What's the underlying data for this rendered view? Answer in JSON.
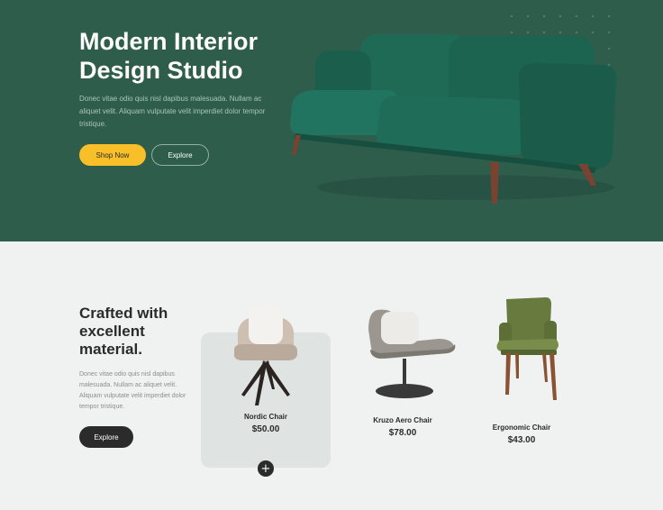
{
  "hero": {
    "title_line1": "Modern Interior",
    "title_line2": "Design Studio",
    "description": "Donec vitae odio quis nisl dapibus malesuada. Nullam ac aliquet velit. Aliquam vulputate velit imperdiet dolor tempor tristique.",
    "shop_label": "Shop Now",
    "explore_label": "Explore",
    "image_icon": "sofa-image"
  },
  "products_section": {
    "title_line1": "Crafted with",
    "title_line2": "excellent",
    "title_line3": "material.",
    "description": "Donec vitae odio quis nisl dapibus malesuada. Nullam ac aliquet velit. Aliquam vulputate velit imperdiet dolor tempor tristique.",
    "explore_label": "Explore",
    "add_icon": "plus-icon",
    "items": [
      {
        "name": "Nordic Chair",
        "price": "$50.00",
        "image_icon": "nordic-chair-image"
      },
      {
        "name": "Kruzo Aero Chair",
        "price": "$78.00",
        "image_icon": "aero-chair-image"
      },
      {
        "name": "Ergonomic Chair",
        "price": "$43.00",
        "image_icon": "ergonomic-chair-image"
      }
    ]
  },
  "colors": {
    "hero_bg": "#2f5d4c",
    "accent_yellow": "#f9bf29",
    "dark": "#2b2b2b",
    "page_bg": "#eff2f0"
  }
}
